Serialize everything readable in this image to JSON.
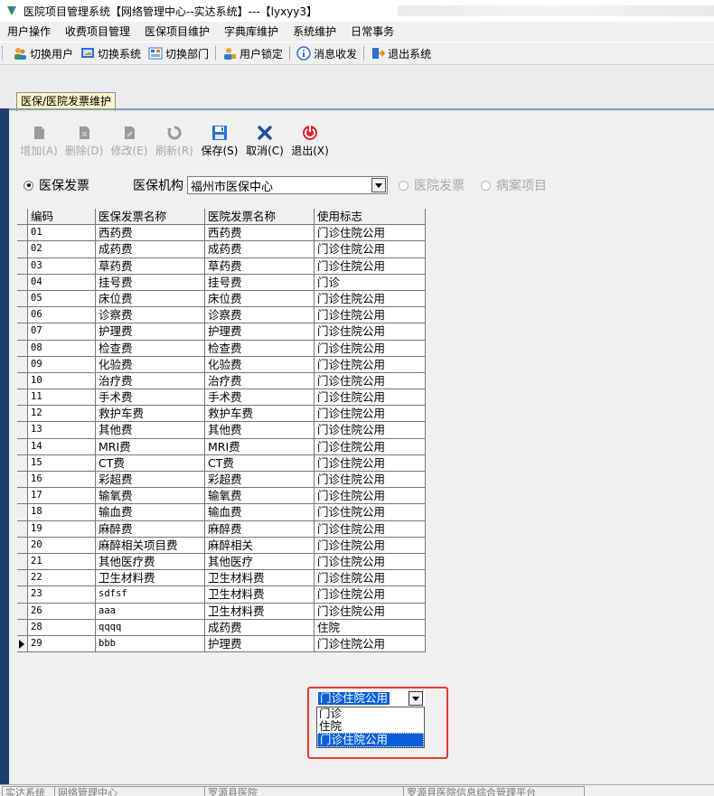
{
  "window": {
    "title": "医院项目管理系统【网络管理中心--实达系统】---【lyxyy3】"
  },
  "menu": [
    "用户操作",
    "收费项目管理",
    "医保项目维护",
    "字典库维护",
    "系统维护",
    "日常事务"
  ],
  "toolbar": {
    "switch_user": "切换用户",
    "switch_system": "切换系统",
    "switch_dept": "切换部门",
    "user_lock": "用户锁定",
    "messages": "消息收发",
    "exit_system": "退出系统"
  },
  "tab": {
    "label": "医保/医院发票维护"
  },
  "actions": {
    "add": "增加(A)",
    "delete": "删除(D)",
    "edit": "修改(E)",
    "refresh": "刷新(R)",
    "save": "保存(S)",
    "cancel": "取消(C)",
    "exit": "退出(X)"
  },
  "filter": {
    "radio_insurance": "医保发票",
    "org_label": "医保机构",
    "org_value": "福州市医保中心",
    "radio_hospital": "医院发票",
    "radio_case": "病案项目"
  },
  "table": {
    "columns": [
      "编码",
      "医保发票名称",
      "医院发票名称",
      "使用标志"
    ],
    "rows": [
      [
        "01",
        "西药费",
        "西药费",
        "门诊住院公用"
      ],
      [
        "02",
        "成药费",
        "成药费",
        "门诊住院公用"
      ],
      [
        "03",
        "草药费",
        "草药费",
        "门诊住院公用"
      ],
      [
        "04",
        "挂号费",
        "挂号费",
        "门诊"
      ],
      [
        "05",
        "床位费",
        "床位费",
        "门诊住院公用"
      ],
      [
        "06",
        "诊察费",
        "诊察费",
        "门诊住院公用"
      ],
      [
        "07",
        "护理费",
        "护理费",
        "门诊住院公用"
      ],
      [
        "08",
        "检查费",
        "检查费",
        "门诊住院公用"
      ],
      [
        "09",
        "化验费",
        "化验费",
        "门诊住院公用"
      ],
      [
        "10",
        "治疗费",
        "治疗费",
        "门诊住院公用"
      ],
      [
        "11",
        "手术费",
        "手术费",
        "门诊住院公用"
      ],
      [
        "12",
        "救护车费",
        "救护车费",
        "门诊住院公用"
      ],
      [
        "13",
        "其他费",
        "其他费",
        "门诊住院公用"
      ],
      [
        "14",
        "MRI费",
        "MRI费",
        "门诊住院公用"
      ],
      [
        "15",
        "CT费",
        "CT费",
        "门诊住院公用"
      ],
      [
        "16",
        "彩超费",
        "彩超费",
        "门诊住院公用"
      ],
      [
        "17",
        "输氧费",
        "输氧费",
        "门诊住院公用"
      ],
      [
        "18",
        "输血费",
        "输血费",
        "门诊住院公用"
      ],
      [
        "19",
        "麻醉费",
        "麻醉费",
        "门诊住院公用"
      ],
      [
        "20",
        "麻醉相关项目费",
        "麻醉相关",
        "门诊住院公用"
      ],
      [
        "21",
        "其他医疗费",
        "其他医疗",
        "门诊住院公用"
      ],
      [
        "22",
        "卫生材料费",
        "卫生材料费",
        "门诊住院公用"
      ],
      [
        "23",
        "sdfsf",
        "卫生材料费",
        "门诊住院公用"
      ],
      [
        "26",
        "aaa",
        "卫生材料费",
        "门诊住院公用"
      ],
      [
        "28",
        "qqqq",
        "成药费",
        "住院"
      ],
      [
        "29",
        "bbb",
        "护理费",
        "门诊住院公用"
      ]
    ]
  },
  "usage_editor": {
    "value": "门诊住院公用",
    "options": [
      "门诊",
      "住院",
      "门诊住院公用"
    ]
  },
  "statusbar": [
    "实达系统",
    "网络管理中心",
    "罗源县医院",
    "罗源县医院信息综合管理平台"
  ]
}
